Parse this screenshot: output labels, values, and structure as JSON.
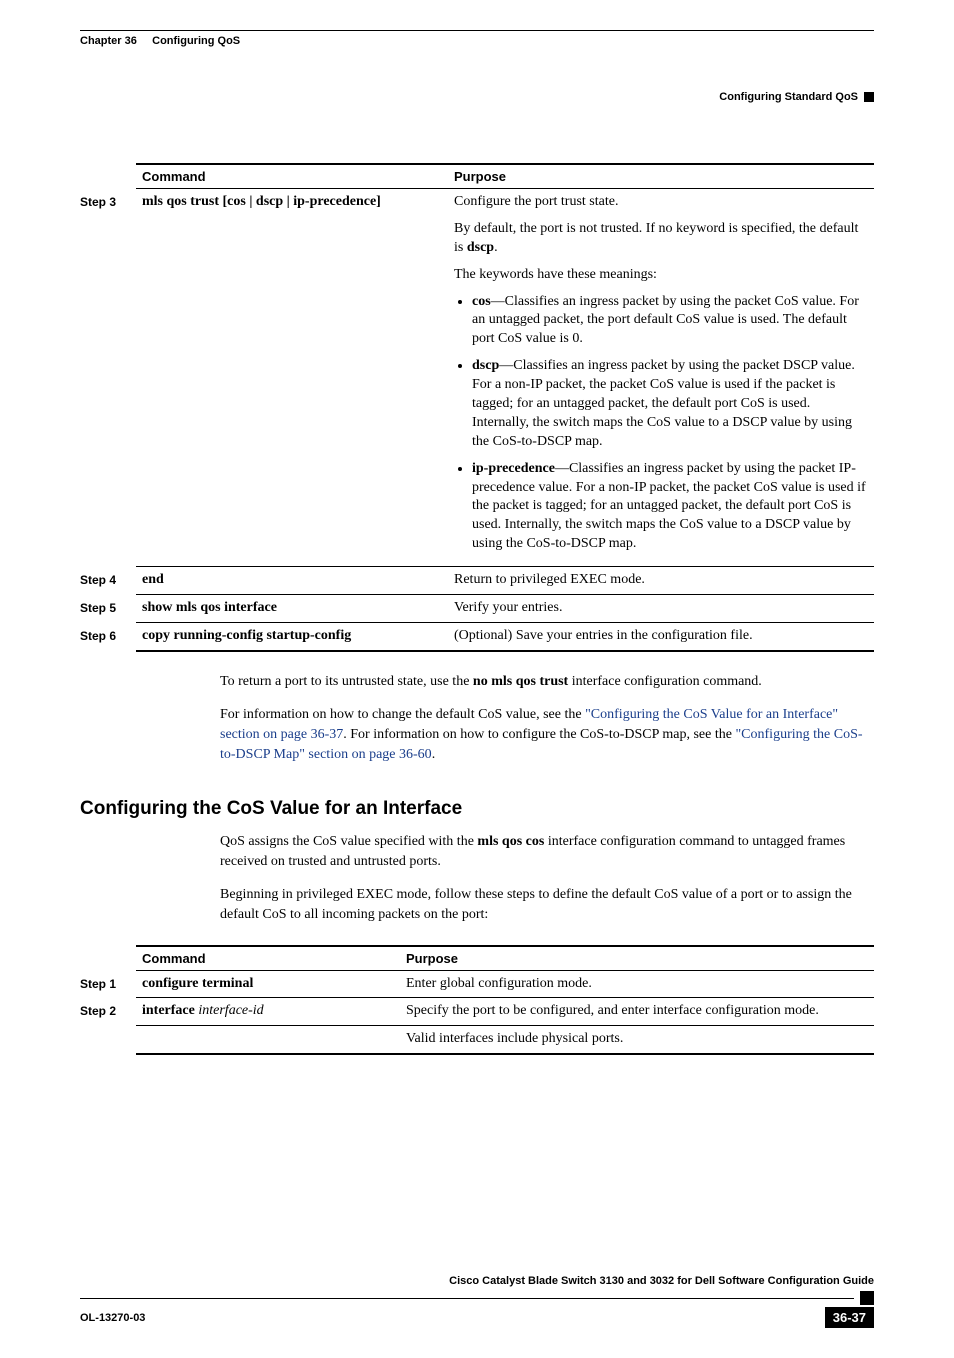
{
  "header": {
    "chapter": "Chapter 36",
    "chapter_title": "Configuring QoS",
    "section_right": "Configuring Standard QoS"
  },
  "table1": {
    "headers": {
      "command": "Command",
      "purpose": "Purpose"
    },
    "rows": [
      {
        "step": "Step 3",
        "command_parts": {
          "pre": "mls qos trust ",
          "args": "[cos | dscp | ip-precedence]"
        },
        "purpose": {
          "p1": "Configure the port trust state.",
          "p2a": "By default, the port is not trusted. If no keyword is specified, the default is ",
          "p2b": "dscp",
          "p2c": ".",
          "p3": "The keywords have these meanings:",
          "bullets": [
            {
              "kw": "cos",
              "text": "—Classifies an ingress packet by using the packet CoS value. For an untagged packet, the port default CoS value is used. The default port CoS value is 0."
            },
            {
              "kw": "dscp",
              "text": "—Classifies an ingress packet by using the packet DSCP value. For a non-IP packet, the packet CoS value is used if the packet is tagged; for an untagged packet, the default port CoS is used. Internally, the switch maps the CoS value to a DSCP value by using the CoS-to-DSCP map."
            },
            {
              "kw": "ip-precedence",
              "text": "—Classifies an ingress packet by using the packet IP-precedence value. For a non-IP packet, the packet CoS value is used if the packet is tagged; for an untagged packet, the default port CoS is used. Internally, the switch maps the CoS value to a DSCP value by using the CoS-to-DSCP map."
            }
          ]
        }
      },
      {
        "step": "Step 4",
        "command": "end",
        "purpose_text": "Return to privileged EXEC mode."
      },
      {
        "step": "Step 5",
        "command": "show mls qos interface",
        "purpose_text": "Verify your entries."
      },
      {
        "step": "Step 6",
        "command": "copy running-config startup-config",
        "purpose_text": "(Optional) Save your entries in the configuration file."
      }
    ]
  },
  "body": {
    "p1a": "To return a port to its untrusted state, use the ",
    "p1b": "no mls qos trust",
    "p1c": " interface configuration command.",
    "p2a": "For information on how to change the default CoS value, see the ",
    "p2link1": "\"Configuring the CoS Value for an Interface\" section on page 36-37",
    "p2b": ". For information on how to configure the CoS-to-DSCP map, see the ",
    "p2link2": "\"Configuring the CoS-to-DSCP Map\" section on page 36-60",
    "p2c": "."
  },
  "section_heading": "Configuring the CoS Value for an Interface",
  "body2": {
    "p1a": "QoS assigns the CoS value specified with the ",
    "p1b": "mls qos cos",
    "p1c": " interface configuration command to untagged frames received on trusted and untrusted ports.",
    "p2": "Beginning in privileged EXEC mode, follow these steps to define the default CoS value of a port or to assign the default CoS to all incoming packets on the port:"
  },
  "table2": {
    "headers": {
      "command": "Command",
      "purpose": "Purpose"
    },
    "rows": [
      {
        "step": "Step 1",
        "command": "configure terminal",
        "purpose_text": "Enter global configuration mode."
      },
      {
        "step": "Step 2",
        "command_parts": {
          "pre": "interface ",
          "arg": "interface-id"
        },
        "purpose_lines": [
          "Specify the port to be configured, and enter interface configuration mode.",
          "Valid interfaces include physical ports."
        ]
      }
    ]
  },
  "footer": {
    "book": "Cisco Catalyst Blade Switch 3130 and 3032 for Dell Software Configuration Guide",
    "doc": "OL-13270-03",
    "page": "36-37"
  }
}
